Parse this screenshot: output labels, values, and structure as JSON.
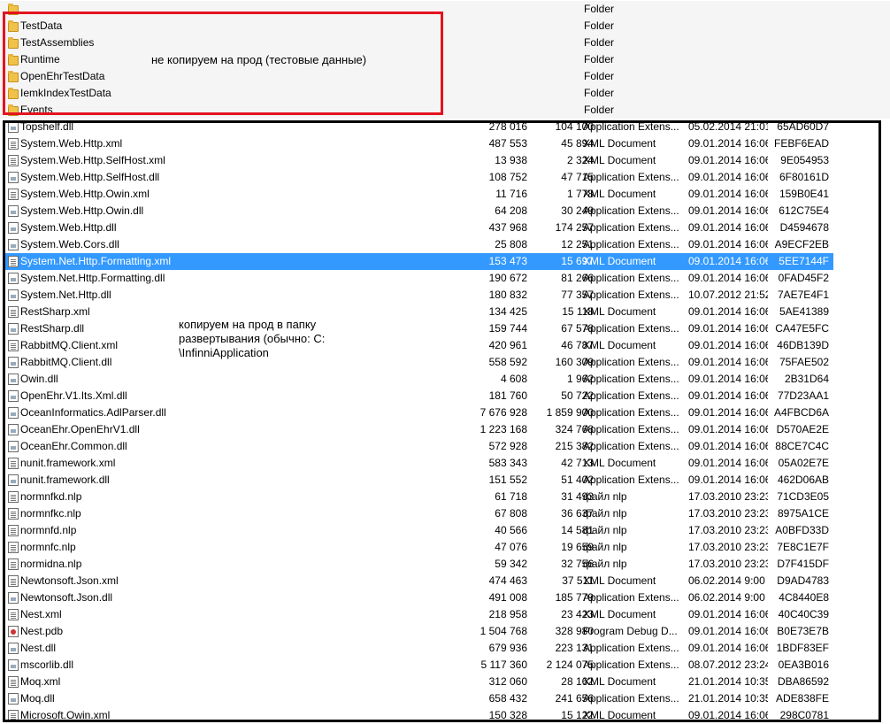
{
  "folders": [
    {
      "name": "",
      "type": "Folder"
    },
    {
      "name": "TestData",
      "type": "Folder"
    },
    {
      "name": "TestAssemblies",
      "type": "Folder"
    },
    {
      "name": "Runtime",
      "type": "Folder"
    },
    {
      "name": "OpenEhrTestData",
      "type": "Folder"
    },
    {
      "name": "IemkIndexTestData",
      "type": "Folder"
    },
    {
      "name": "Events",
      "type": "Folder"
    }
  ],
  "files": [
    {
      "name": "Topshelf.dll",
      "size": "278 016",
      "packed": "104 100",
      "type": "Application Extens...",
      "modified": "05.02.2014 21:01",
      "crc": "65AD60D7",
      "icon": "dll"
    },
    {
      "name": "System.Web.Http.xml",
      "size": "487 553",
      "packed": "45 894",
      "type": "XML Document",
      "modified": "09.01.2014 16:06",
      "crc": "FEBF6EAD",
      "icon": "doc"
    },
    {
      "name": "System.Web.Http.SelfHost.xml",
      "size": "13 938",
      "packed": "2 324",
      "type": "XML Document",
      "modified": "09.01.2014 16:06",
      "crc": "9E054953",
      "icon": "doc"
    },
    {
      "name": "System.Web.Http.SelfHost.dll",
      "size": "108 752",
      "packed": "47 715",
      "type": "Application Extens...",
      "modified": "09.01.2014 16:06",
      "crc": "6F80161D",
      "icon": "dll"
    },
    {
      "name": "System.Web.Http.Owin.xml",
      "size": "11 716",
      "packed": "1 778",
      "type": "XML Document",
      "modified": "09.01.2014 16:06",
      "crc": "159B0E41",
      "icon": "doc"
    },
    {
      "name": "System.Web.Http.Owin.dll",
      "size": "64 208",
      "packed": "30 249",
      "type": "Application Extens...",
      "modified": "09.01.2014 16:06",
      "crc": "612C75E4",
      "icon": "dll"
    },
    {
      "name": "System.Web.Http.dll",
      "size": "437 968",
      "packed": "174 257",
      "type": "Application Extens...",
      "modified": "09.01.2014 16:06",
      "crc": "D4594678",
      "icon": "dll"
    },
    {
      "name": "System.Web.Cors.dll",
      "size": "25 808",
      "packed": "12 251",
      "type": "Application Extens...",
      "modified": "09.01.2014 16:06",
      "crc": "A9ECF2EB",
      "icon": "dll"
    },
    {
      "name": "System.Net.Http.Formatting.xml",
      "size": "153 473",
      "packed": "15 697",
      "type": "XML Document",
      "modified": "09.01.2014 16:06",
      "crc": "5EE7144F",
      "icon": "doc",
      "selected": true
    },
    {
      "name": "System.Net.Http.Formatting.dll",
      "size": "190 672",
      "packed": "81 266",
      "type": "Application Extens...",
      "modified": "09.01.2014 16:06",
      "crc": "0FAD45F2",
      "icon": "dll"
    },
    {
      "name": "System.Net.Http.dll",
      "size": "180 832",
      "packed": "77 357",
      "type": "Application Extens...",
      "modified": "10.07.2012 21:52",
      "crc": "7AE7E4F1",
      "icon": "dll"
    },
    {
      "name": "RestSharp.xml",
      "size": "134 425",
      "packed": "15 118",
      "type": "XML Document",
      "modified": "09.01.2014 16:06",
      "crc": "5AE41389",
      "icon": "doc"
    },
    {
      "name": "RestSharp.dll",
      "size": "159 744",
      "packed": "67 578",
      "type": "Application Extens...",
      "modified": "09.01.2014 16:06",
      "crc": "CA47E5FC",
      "icon": "dll"
    },
    {
      "name": "RabbitMQ.Client.xml",
      "size": "420 961",
      "packed": "46 787",
      "type": "XML Document",
      "modified": "09.01.2014 16:06",
      "crc": "46DB139D",
      "icon": "doc"
    },
    {
      "name": "RabbitMQ.Client.dll",
      "size": "558 592",
      "packed": "160 309",
      "type": "Application Extens...",
      "modified": "09.01.2014 16:06",
      "crc": "75FAE502",
      "icon": "dll"
    },
    {
      "name": "Owin.dll",
      "size": "4 608",
      "packed": "1 962",
      "type": "Application Extens...",
      "modified": "09.01.2014 16:06",
      "crc": "2B31D64",
      "icon": "dll"
    },
    {
      "name": "OpenEhr.V1.Its.Xml.dll",
      "size": "181 760",
      "packed": "50 722",
      "type": "Application Extens...",
      "modified": "09.01.2014 16:06",
      "crc": "77D23AA1",
      "icon": "dll"
    },
    {
      "name": "OceanInformatics.AdlParser.dll",
      "size": "7 676 928",
      "packed": "1 859 900",
      "type": "Application Extens...",
      "modified": "09.01.2014 16:06",
      "crc": "A4FBCD6A",
      "icon": "dll"
    },
    {
      "name": "OceanEhr.OpenEhrV1.dll",
      "size": "1 223 168",
      "packed": "324 768",
      "type": "Application Extens...",
      "modified": "09.01.2014 16:06",
      "crc": "D570AE2E",
      "icon": "dll"
    },
    {
      "name": "OceanEhr.Common.dll",
      "size": "572 928",
      "packed": "215 382",
      "type": "Application Extens...",
      "modified": "09.01.2014 16:06",
      "crc": "88CE7C4C",
      "icon": "dll"
    },
    {
      "name": "nunit.framework.xml",
      "size": "583 343",
      "packed": "42 713",
      "type": "XML Document",
      "modified": "09.01.2014 16:06",
      "crc": "05A02E7E",
      "icon": "doc"
    },
    {
      "name": "nunit.framework.dll",
      "size": "151 552",
      "packed": "51 402",
      "type": "Application Extens...",
      "modified": "09.01.2014 16:06",
      "crc": "462D06AB",
      "icon": "dll"
    },
    {
      "name": "normnfkd.nlp",
      "size": "61 718",
      "packed": "31 493",
      "type": "файл nlp",
      "modified": "17.03.2010 23:23",
      "crc": "71CD3E05",
      "icon": "doc"
    },
    {
      "name": "normnfkc.nlp",
      "size": "67 808",
      "packed": "36 637",
      "type": "файл nlp",
      "modified": "17.03.2010 23:23",
      "crc": "8975A1CE",
      "icon": "doc"
    },
    {
      "name": "normnfd.nlp",
      "size": "40 566",
      "packed": "14 581",
      "type": "файл nlp",
      "modified": "17.03.2010 23:23",
      "crc": "A0BFD33D",
      "icon": "doc"
    },
    {
      "name": "normnfc.nlp",
      "size": "47 076",
      "packed": "19 659",
      "type": "файл nlp",
      "modified": "17.03.2010 23:23",
      "crc": "7E8C1E7F",
      "icon": "doc"
    },
    {
      "name": "normidna.nlp",
      "size": "59 342",
      "packed": "32 756",
      "type": "файл nlp",
      "modified": "17.03.2010 23:23",
      "crc": "D7F415DF",
      "icon": "doc"
    },
    {
      "name": "Newtonsoft.Json.xml",
      "size": "474 463",
      "packed": "37 511",
      "type": "XML Document",
      "modified": "06.02.2014 9:00",
      "crc": "D9AD4783",
      "icon": "doc"
    },
    {
      "name": "Newtonsoft.Json.dll",
      "size": "491 008",
      "packed": "185 779",
      "type": "Application Extens...",
      "modified": "06.02.2014 9:00",
      "crc": "4C8440E8",
      "icon": "dll"
    },
    {
      "name": "Nest.xml",
      "size": "218 958",
      "packed": "23 423",
      "type": "XML Document",
      "modified": "09.01.2014 16:06",
      "crc": "40C40C39",
      "icon": "doc"
    },
    {
      "name": "Nest.pdb",
      "size": "1 504 768",
      "packed": "328 980",
      "type": "Program Debug D...",
      "modified": "09.01.2014 16:06",
      "crc": "B0E73E7B",
      "icon": "pdb"
    },
    {
      "name": "Nest.dll",
      "size": "679 936",
      "packed": "223 131",
      "type": "Application Extens...",
      "modified": "09.01.2014 16:06",
      "crc": "1BDF83EF",
      "icon": "dll"
    },
    {
      "name": "mscorlib.dll",
      "size": "5 117 360",
      "packed": "2 124 075",
      "type": "Application Extens...",
      "modified": "08.07.2012 23:24",
      "crc": "0EA3B016",
      "icon": "dll"
    },
    {
      "name": "Moq.xml",
      "size": "312 060",
      "packed": "28 162",
      "type": "XML Document",
      "modified": "21.01.2014 10:35",
      "crc": "DBA86592",
      "icon": "doc"
    },
    {
      "name": "Moq.dll",
      "size": "658 432",
      "packed": "241 656",
      "type": "Application Extens...",
      "modified": "21.01.2014 10:35",
      "crc": "ADE838FE",
      "icon": "dll"
    },
    {
      "name": "Microsoft.Owin.xml",
      "size": "150 328",
      "packed": "15 122",
      "type": "XML Document",
      "modified": "09.01.2014 16:06",
      "crc": "298C0781",
      "icon": "doc"
    }
  ],
  "annotations": {
    "test_note": "не копируем на прод (тестовые данные)",
    "deploy_note": "копируем на прод в папку развертывания (обычно: C:\n\\InfinniApplication"
  },
  "colors": {
    "selection": "#3399ff",
    "test_box": "#e3141f",
    "deploy_box": "#000000",
    "folder_bg": "#f5f5f5"
  }
}
